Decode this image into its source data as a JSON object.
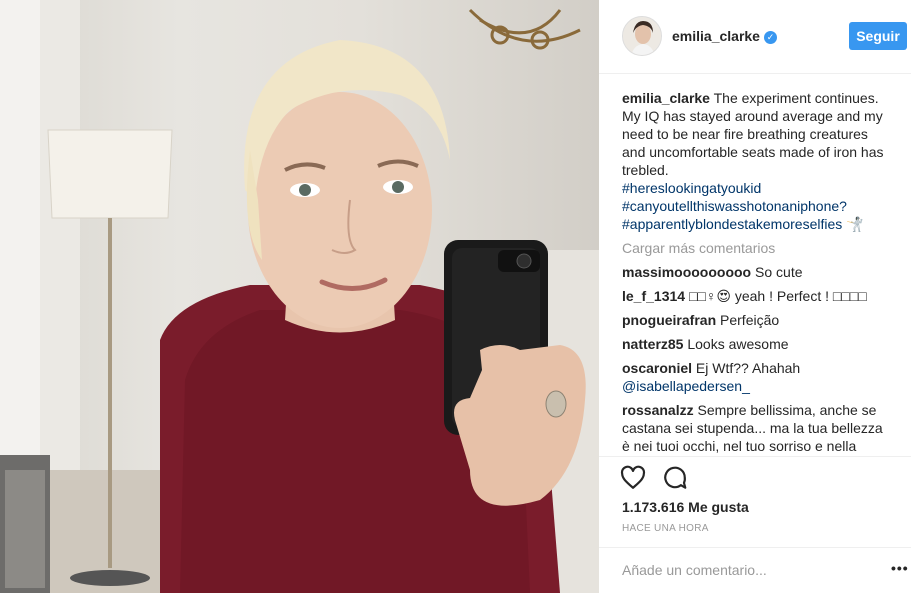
{
  "post": {
    "image_alt": "photo"
  },
  "header": {
    "username": "emilia_clarke",
    "follow_label": "Seguir"
  },
  "caption": {
    "username": "emilia_clarke",
    "text": "The experiment continues. My IQ has stayed around average and my need to be near fire breathing creatures and uncomfortable seats made of iron has trebled.",
    "hashtags": [
      "#hereslookingatyoukid",
      "#canyoutellthiswasshotonaniphone?",
      "#apparentlyblondestakemoreselfies 🤺"
    ]
  },
  "load_more_label": "Cargar más comentarios",
  "comments": [
    {
      "username": "massimooooooooo",
      "text": "So cute"
    },
    {
      "username": "le_f_1314",
      "text": "□□♀😍 yeah ! Perfect ! □□□□"
    },
    {
      "username": "pnogueirafran",
      "text": "Perfeição"
    },
    {
      "username": "natterz85",
      "text": "Looks awesome"
    },
    {
      "username": "oscaroniel",
      "text": "Ej Wtf?? Ahahah",
      "mention": "@isabellapedersen_"
    },
    {
      "username": "rossanalzz",
      "text": "Sempre bellissima, anche se castana sei stupenda... ma la tua bellezza è nei tuoi occhi, nel tuo sorriso e nella"
    }
  ],
  "likes": "1.173.616 Me gusta",
  "timestamp": "HACE UNA HORA",
  "add_comment_placeholder": "Añade un comentario...",
  "more_label": "•••",
  "icons": {
    "verified": "verified-badge-icon",
    "like": "heart-icon",
    "comment": "comment-bubble-icon",
    "more": "more-options-icon"
  },
  "colors": {
    "accent": "#3897f0",
    "hashtag": "#003569",
    "muted": "#999999"
  }
}
